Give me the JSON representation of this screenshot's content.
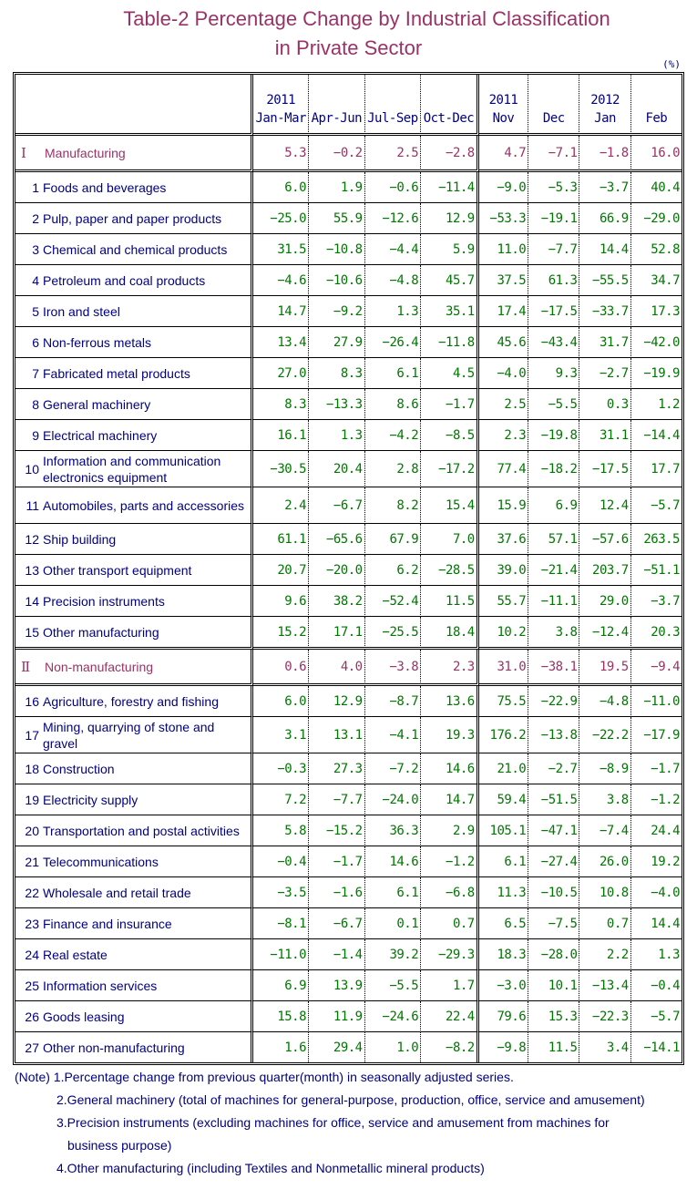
{
  "title": {
    "line1": "Table-2   Percentage Change by Industrial Classification",
    "line2": "in Private Sector"
  },
  "unit": "(%)",
  "columns": [
    {
      "year": "2011",
      "period": "Jan-Mar"
    },
    {
      "year": "",
      "period": "Apr-Jun"
    },
    {
      "year": "",
      "period": "Jul-Sep"
    },
    {
      "year": "",
      "period": "Oct-Dec"
    },
    {
      "year": "2011",
      "period": "Nov"
    },
    {
      "year": "",
      "period": "Dec"
    },
    {
      "year": "2012",
      "period": "Jan"
    },
    {
      "year": "",
      "period": "Feb"
    }
  ],
  "rows": [
    {
      "type": "section",
      "num": "Ⅰ",
      "label": "Manufacturing",
      "values": [
        "5.3",
        "−0.2",
        "2.5",
        "−2.8",
        "4.7",
        "−7.1",
        "−1.8",
        "16.0"
      ]
    },
    {
      "type": "item",
      "num": "1",
      "label": "Foods and beverages",
      "values": [
        "6.0",
        "1.9",
        "−0.6",
        "−11.4",
        "−9.0",
        "−5.3",
        "−3.7",
        "40.4"
      ]
    },
    {
      "type": "item",
      "num": "2",
      "label": "Pulp, paper and paper products",
      "values": [
        "−25.0",
        "55.9",
        "−12.6",
        "12.9",
        "−53.3",
        "−19.1",
        "66.9",
        "−29.0"
      ]
    },
    {
      "type": "item",
      "num": "3",
      "label": "Chemical and chemical products",
      "values": [
        "31.5",
        "−10.8",
        "−4.4",
        "5.9",
        "11.0",
        "−7.7",
        "14.4",
        "52.8"
      ]
    },
    {
      "type": "item",
      "num": "4",
      "label": "Petroleum and coal products",
      "values": [
        "−4.6",
        "−10.6",
        "−4.8",
        "45.7",
        "37.5",
        "61.3",
        "−55.5",
        "34.7"
      ]
    },
    {
      "type": "item",
      "num": "5",
      "label": "Iron and steel",
      "values": [
        "14.7",
        "−9.2",
        "1.3",
        "35.1",
        "17.4",
        "−17.5",
        "−33.7",
        "17.3"
      ]
    },
    {
      "type": "item",
      "num": "6",
      "label": "Non-ferrous metals",
      "values": [
        "13.4",
        "27.9",
        "−26.4",
        "−11.8",
        "45.6",
        "−43.4",
        "31.7",
        "−42.0"
      ]
    },
    {
      "type": "item",
      "num": "7",
      "label": "Fabricated metal products",
      "values": [
        "27.0",
        "8.3",
        "6.1",
        "4.5",
        "−4.0",
        "9.3",
        "−2.7",
        "−19.9"
      ]
    },
    {
      "type": "item",
      "num": "8",
      "label": "General machinery",
      "values": [
        "8.3",
        "−13.3",
        "8.6",
        "−1.7",
        "2.5",
        "−5.5",
        "0.3",
        "1.2"
      ]
    },
    {
      "type": "item",
      "num": "9",
      "label": "Electrical machinery",
      "values": [
        "16.1",
        "1.3",
        "−4.2",
        "−8.5",
        "2.3",
        "−19.8",
        "31.1",
        "−14.4"
      ]
    },
    {
      "type": "wrap",
      "num": "10",
      "label": "Information and communication electronics equipment",
      "values": [
        "−30.5",
        "20.4",
        "2.8",
        "−17.2",
        "77.4",
        "−18.2",
        "−17.5",
        "17.7"
      ]
    },
    {
      "type": "wrap",
      "num": "11",
      "label": "Automobiles, parts and accessories",
      "values": [
        "2.4",
        "−6.7",
        "8.2",
        "15.4",
        "15.9",
        "6.9",
        "12.4",
        "−5.7"
      ]
    },
    {
      "type": "item",
      "num": "12",
      "label": "Ship building",
      "values": [
        "61.1",
        "−65.6",
        "67.9",
        "7.0",
        "37.6",
        "57.1",
        "−57.6",
        "263.5"
      ]
    },
    {
      "type": "item",
      "num": "13",
      "label": "Other transport equipment",
      "values": [
        "20.7",
        "−20.0",
        "6.2",
        "−28.5",
        "39.0",
        "−21.4",
        "203.7",
        "−51.1"
      ]
    },
    {
      "type": "item",
      "num": "14",
      "label": "Precision instruments",
      "values": [
        "9.6",
        "38.2",
        "−52.4",
        "11.5",
        "55.7",
        "−11.1",
        "29.0",
        "−3.7"
      ]
    },
    {
      "type": "item",
      "num": "15",
      "label": "Other manufacturing",
      "values": [
        "15.2",
        "17.1",
        "−25.5",
        "18.4",
        "10.2",
        "3.8",
        "−12.4",
        "20.3"
      ]
    },
    {
      "type": "section",
      "num": "Ⅱ",
      "label": "Non-manufacturing",
      "values": [
        "0.6",
        "4.0",
        "−3.8",
        "2.3",
        "31.0",
        "−38.1",
        "19.5",
        "−9.4"
      ]
    },
    {
      "type": "item",
      "num": "16",
      "label": "Agriculture, forestry and fishing",
      "values": [
        "6.0",
        "12.9",
        "−8.7",
        "13.6",
        "75.5",
        "−22.9",
        "−4.8",
        "−11.0"
      ]
    },
    {
      "type": "wrap",
      "num": "17",
      "label": "Mining, quarrying of stone and gravel",
      "values": [
        "3.1",
        "13.1",
        "−4.1",
        "19.3",
        "176.2",
        "−13.8",
        "−22.2",
        "−17.9"
      ]
    },
    {
      "type": "item",
      "num": "18",
      "label": "Construction",
      "values": [
        "−0.3",
        "27.3",
        "−7.2",
        "14.6",
        "21.0",
        "−2.7",
        "−8.9",
        "−1.7"
      ]
    },
    {
      "type": "item",
      "num": "19",
      "label": "Electricity supply",
      "values": [
        "7.2",
        "−7.7",
        "−24.0",
        "14.7",
        "59.4",
        "−51.5",
        "3.8",
        "−1.2"
      ]
    },
    {
      "type": "item",
      "num": "20",
      "label": "Transportation and postal activities",
      "values": [
        "5.8",
        "−15.2",
        "36.3",
        "2.9",
        "105.1",
        "−47.1",
        "−7.4",
        "24.4"
      ]
    },
    {
      "type": "item",
      "num": "21",
      "label": "Telecommunications",
      "values": [
        "−0.4",
        "−1.7",
        "14.6",
        "−1.2",
        "6.1",
        "−27.4",
        "26.0",
        "19.2"
      ]
    },
    {
      "type": "item",
      "num": "22",
      "label": "Wholesale and retail trade",
      "values": [
        "−3.5",
        "−1.6",
        "6.1",
        "−6.8",
        "11.3",
        "−10.5",
        "10.8",
        "−4.0"
      ]
    },
    {
      "type": "item",
      "num": "23",
      "label": "Finance and insurance",
      "values": [
        "−8.1",
        "−6.7",
        "0.1",
        "0.7",
        "6.5",
        "−7.5",
        "0.7",
        "14.4"
      ]
    },
    {
      "type": "item",
      "num": "24",
      "label": "Real estate",
      "values": [
        "−11.0",
        "−1.4",
        "39.2",
        "−29.3",
        "18.3",
        "−28.0",
        "2.2",
        "1.3"
      ]
    },
    {
      "type": "item",
      "num": "25",
      "label": "Information services",
      "values": [
        "6.9",
        "13.9",
        "−5.5",
        "1.7",
        "−3.0",
        "10.1",
        "−13.4",
        "−0.4"
      ]
    },
    {
      "type": "item",
      "num": "26",
      "label": "Goods leasing",
      "values": [
        "15.8",
        "11.9",
        "−24.6",
        "22.4",
        "79.6",
        "15.3",
        "−22.3",
        "−5.7"
      ]
    },
    {
      "type": "item",
      "num": "27",
      "label": "Other non-manufacturing",
      "values": [
        "1.6",
        "29.4",
        "1.0",
        "−8.2",
        "−9.8",
        "11.5",
        "3.4",
        "−14.1"
      ]
    }
  ],
  "notes": {
    "n1": "(Note) 1.Percentage change from previous quarter(month) in seasonally adjusted series.",
    "n2": "2.General machinery (total of machines for general-purpose, production, office, service and amusement)",
    "n3a": "3.Precision instruments (excluding machines for office, service and amusement from machines for",
    "n3b": "business purpose)",
    "n4": "4.Other manufacturing (including Textiles and Nonmetallic mineral products)"
  },
  "colors": {
    "title": "#993366",
    "label": "#000080",
    "value": "#007700",
    "section": "#993366"
  }
}
